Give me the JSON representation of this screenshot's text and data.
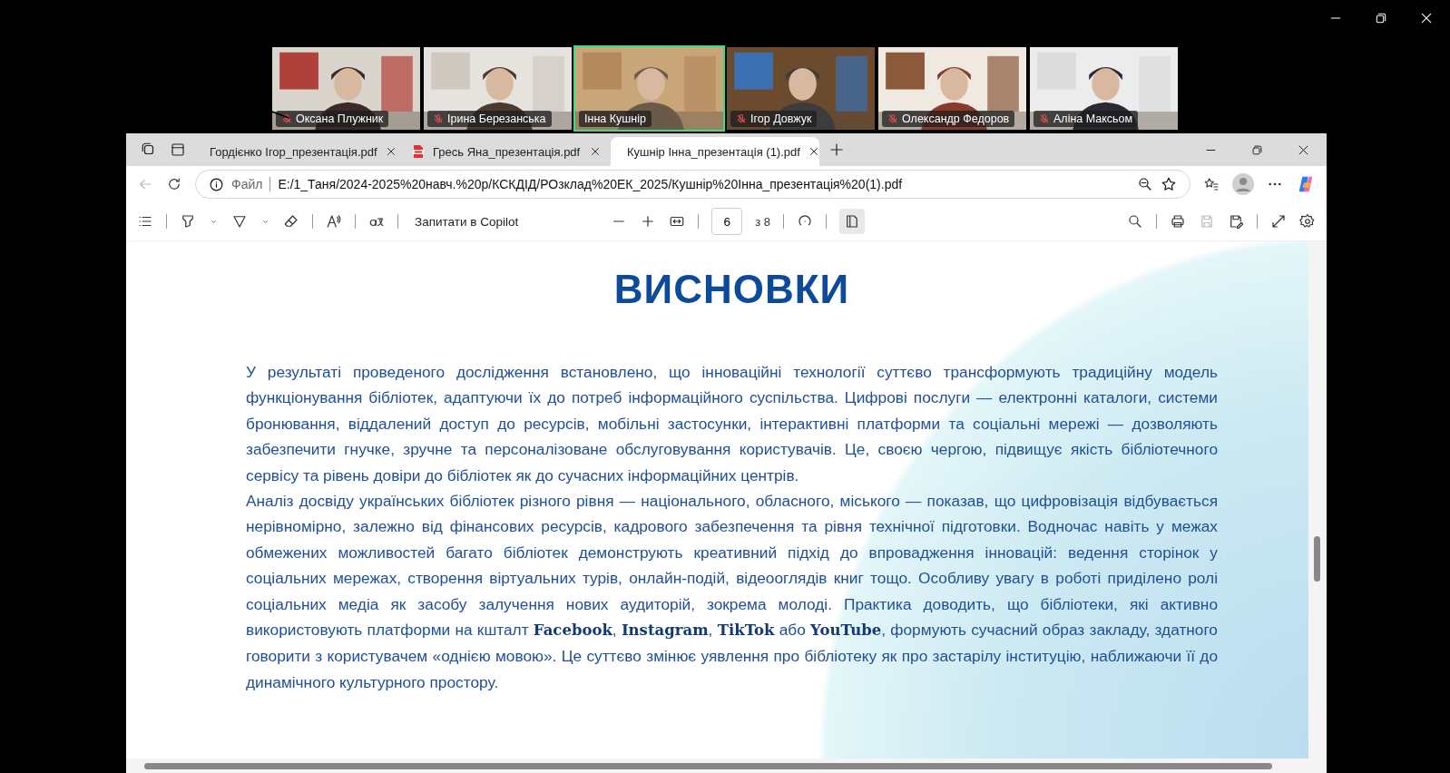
{
  "participants": [
    {
      "name": "Оксана Плужник",
      "muted": true,
      "speaking": false
    },
    {
      "name": "Ірина Березанська",
      "muted": true,
      "speaking": false
    },
    {
      "name": "Інна Кушнір",
      "muted": false,
      "speaking": true
    },
    {
      "name": "Ігор Довжук",
      "muted": true,
      "speaking": false
    },
    {
      "name": "Олександр Федоров",
      "muted": true,
      "speaking": false
    },
    {
      "name": "Аліна Максьом",
      "muted": true,
      "speaking": false
    }
  ],
  "browser": {
    "tabs": [
      {
        "title": "Гордієнко Ігор_презентація.pdf",
        "selected": false
      },
      {
        "title": "Гресь Яна_презентація.pdf",
        "selected": false
      },
      {
        "title": "Кушнір Інна_презентація (1).pdf",
        "selected": true
      }
    ],
    "address": {
      "scheme": "Файл",
      "url": "E:/1_Таня/2024-2025%20навч.%20р/КСКДІД/РОзклад%20ЕК_2025/Кушнір%20Інна_презентація%20(1).pdf"
    },
    "pdf_toolbar": {
      "copilot": "Запитати в Copilot",
      "page": "6",
      "page_total": "з 8"
    }
  },
  "document": {
    "title": "ВИСНОВКИ",
    "paragraphs": [
      "У результаті проведеного дослідження встановлено, що інноваційні технології суттєво трансформують традиційну модель функціонування бібліотек, адаптуючи їх до потреб інформаційного суспільства. Цифрові послуги — електронні каталоги, системи бронювання, віддалений доступ до ресурсів, мобільні застосунки, інтерактивні платформи та соціальні мережі — дозволяють забезпечити гнучке, зручне та персоналізоване обслуговування користувачів. Це, своєю чергою, підвищує якість бібліотечного сервісу та рівень довіри до бібліотек як до сучасних інформаційних центрів.",
      "Аналіз досвіду українських бібліотек різного рівня — національного, обласного, міського — показав, що цифровізація відбувається нерівномірно, залежно від фінансових ресурсів, кадрового забезпечення та рівня технічної підготовки. Водночас навіть у межах обмежених можливостей багато бібліотек демонструють креативний підхід до впровадження інновацій: ведення сторінок у соціальних мережах, створення віртуальних турів, онлайн-подій, відеооглядів книг тощо. Особливу увагу в роботі приділено ролі соціальних медіа як засобу залучення нових аудиторій, зокрема молоді. Практика доводить, що бібліотеки, які активно використовують платформи на кшталт **Facebook**, **Instagram**, **TikTok** або **YouTube**, формують сучасний образ закладу, здатного говорити з користувачем «однією мовою». Це суттєво змінює уявлення про бібліотеку як про застарілу інституцію, наближаючи її до динамічного культурного простору."
    ]
  }
}
